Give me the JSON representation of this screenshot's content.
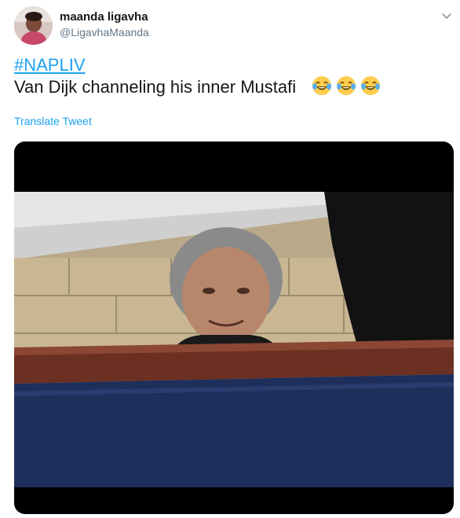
{
  "tweet": {
    "author_name": "maanda ligavha",
    "author_handle": "@LigavhaMaanda",
    "hashtag": "#NAPLIV",
    "text": "Van Dijk channeling his inner Mustafi",
    "emoji_icon": "face-with-tears-of-joy-icon",
    "emoji_count": 3,
    "translate_label": "Translate Tweet"
  },
  "colors": {
    "link": "#1da1f2",
    "text": "#14171a",
    "muted": "#657786"
  }
}
